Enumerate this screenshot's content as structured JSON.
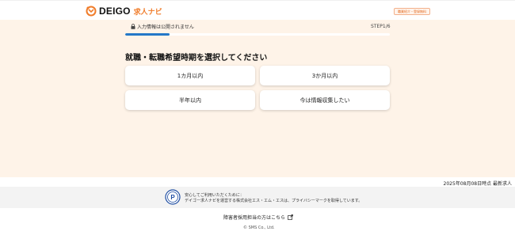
{
  "header": {
    "logo_text": "DEIGO",
    "logo_sub": "求人ナビ",
    "badge": "職業紹介・登録無料"
  },
  "progress": {
    "privacy_text": "入力情報は公開されません",
    "step_text": "STEP1/6",
    "fraction": 0.1667
  },
  "question": {
    "title": "就職・転職希望時期を選択してください",
    "options": [
      "1カ月以内",
      "3か月以内",
      "半年以内",
      "今は情報収集したい"
    ]
  },
  "updated_text": "2025年08月08日時点 最新求人",
  "pmark": {
    "title": "安心してご利用いただくために：",
    "description": "デイゴー求人ナビを運営する株式会社エス・エム・エスは、プライバシーマークを取得しています。"
  },
  "footer": {
    "disability_link": "障害者採用担当の方はこちら",
    "copyright": "© SMS Co., Ltd."
  },
  "colors": {
    "brand_orange": "#f07c2a",
    "progress_blue": "#2478c8",
    "main_background": "#fef3e8"
  }
}
